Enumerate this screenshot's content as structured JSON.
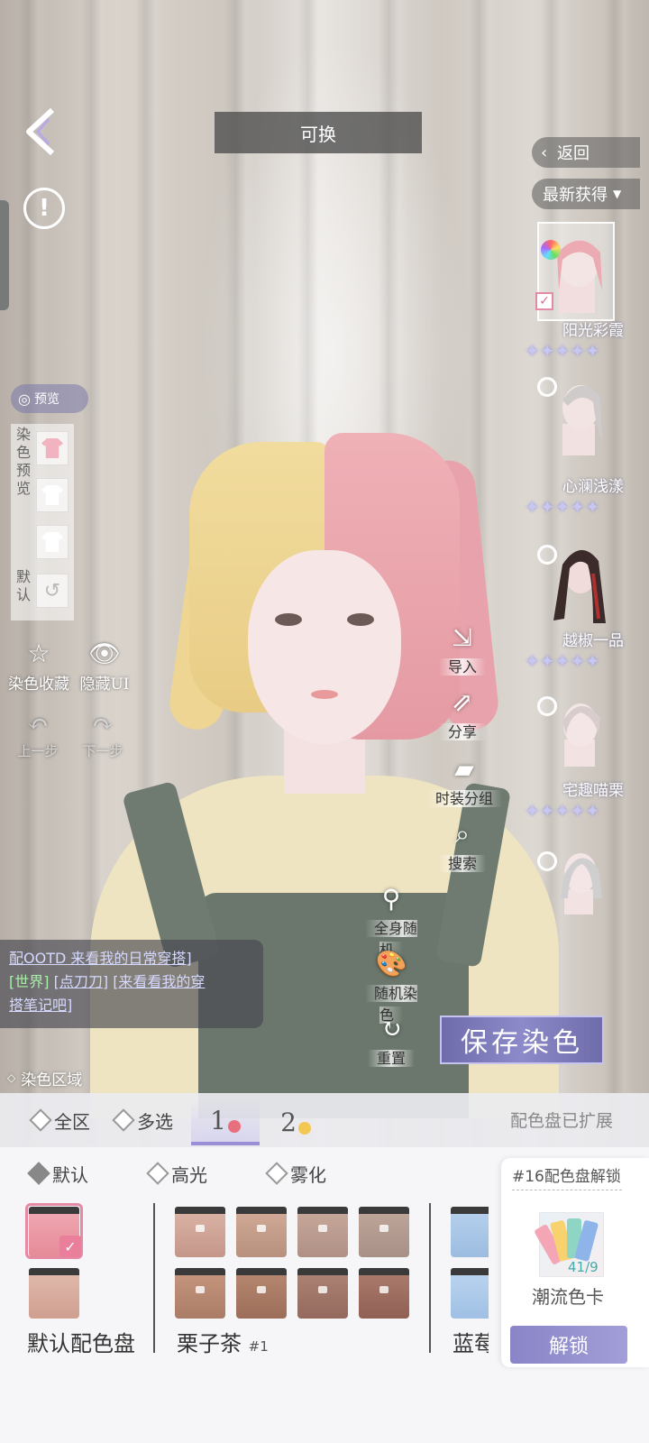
{
  "header": {
    "title": "可换"
  },
  "right_panel": {
    "return_label": "返回",
    "sort_label": "最新获得",
    "items": [
      {
        "name": "阳光彩霞",
        "selected": true,
        "stars": 5
      },
      {
        "name": "心澜浅漾",
        "selected": false,
        "stars": 5
      },
      {
        "name": "越椒一品",
        "selected": false,
        "stars": 5
      },
      {
        "name": "宅趣喵栗",
        "selected": false,
        "stars": 5
      },
      {
        "name": "",
        "selected": false,
        "stars": 0
      }
    ]
  },
  "left_panel": {
    "preview_label": "预览",
    "dye_preview_label": [
      "染",
      "色",
      "预",
      "览"
    ],
    "default_label": [
      "默",
      "认"
    ],
    "tools": {
      "favorite": "染色收藏",
      "hide_ui": "隐藏UI",
      "undo": "上一步",
      "redo": "下一步"
    }
  },
  "actions": {
    "import": "导入",
    "share": "分享",
    "group": "时装分组",
    "search": "搜索",
    "random_body": "全身随机",
    "random_dye": "随机染色",
    "reset": "重置"
  },
  "chat": {
    "line1": "配OOTD 来看我的日常穿搭]",
    "channel": "[世界]",
    "user": "[点刀刀]",
    "line2_msg": "[来看看我的穿",
    "line3": "搭笔记吧]"
  },
  "save_button": "保存染色",
  "dye_region": {
    "label": "染色区域",
    "options": {
      "all": "全区",
      "multi": "多选"
    },
    "tabs": [
      {
        "label": "1",
        "dot_color": "#e8707e",
        "active": true
      },
      {
        "label": "2",
        "dot_color": "#f3c852",
        "active": false
      }
    ],
    "expanded_label": "配色盘已扩展"
  },
  "sub_options": {
    "default": "默认",
    "highlight": "高光",
    "mist": "雾化"
  },
  "palettes": [
    {
      "name": "默认配色盘",
      "suffix": ""
    },
    {
      "name": "栗子茶",
      "suffix": "#1"
    },
    {
      "name": "蓝莓",
      "suffix": ""
    }
  ],
  "swatch_colors": {
    "default": [
      "#ec9aa6",
      "#d9b0a2"
    ],
    "chestnut_row1": [
      "#cfa594",
      "#c69a88",
      "#bb9b8e",
      "#b3998f"
    ],
    "chestnut_row2": [
      "#b78a72",
      "#a97c66",
      "#a0766a",
      "#9e7063"
    ],
    "blue": [
      "#a8c6e6",
      "#a9c8ea"
    ]
  },
  "unlock_card": {
    "title": "#16配色盘解锁",
    "count": "41/9",
    "card_name": "潮流色卡",
    "button": "解锁"
  }
}
